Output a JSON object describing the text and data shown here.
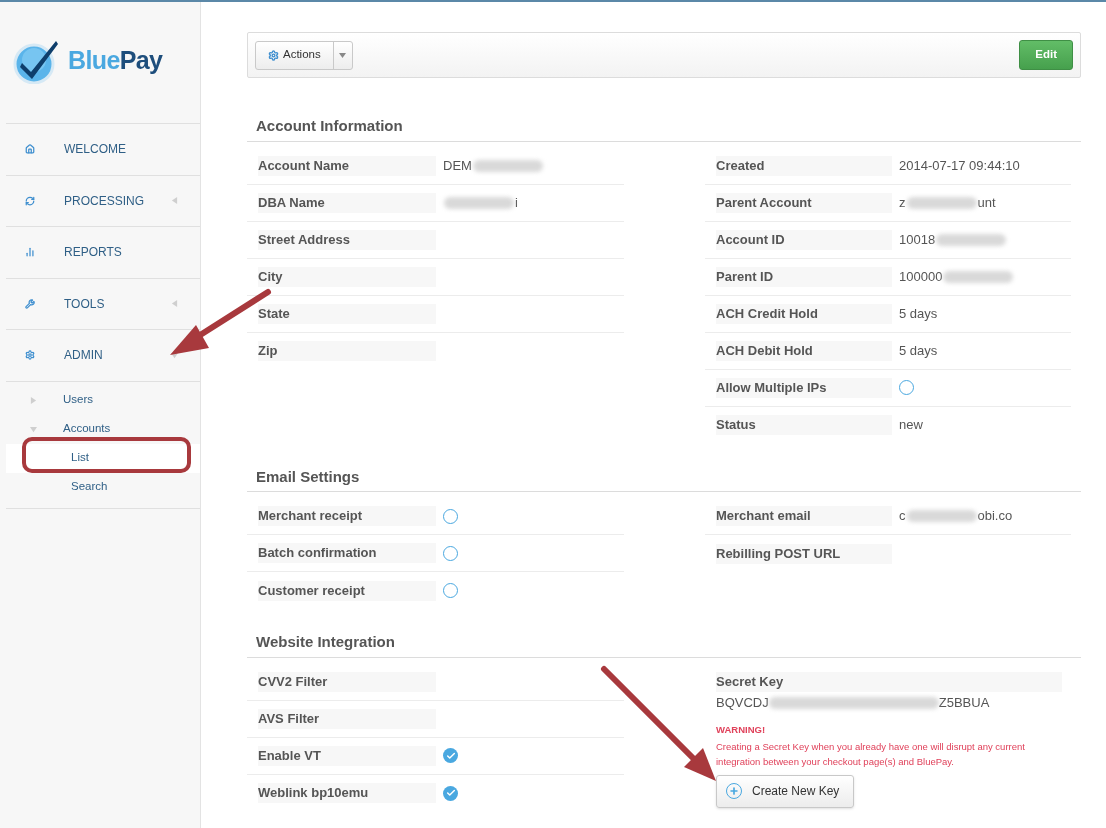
{
  "logo": {
    "text_light": "Blue",
    "text_dark": "Pay"
  },
  "sidebar": {
    "items": [
      {
        "label": "WELCOME"
      },
      {
        "label": "PROCESSING",
        "expanded": false
      },
      {
        "label": "REPORTS"
      },
      {
        "label": "TOOLS",
        "expanded": false
      },
      {
        "label": "ADMIN",
        "expanded": true,
        "children": [
          {
            "label": "Users",
            "expanded": false
          },
          {
            "label": "Accounts",
            "expanded": true,
            "children": [
              {
                "label": "List",
                "selected": true
              },
              {
                "label": "Search",
                "selected": false
              }
            ]
          }
        ]
      }
    ]
  },
  "toolbar": {
    "actions_label": "Actions",
    "edit_label": "Edit"
  },
  "sections": [
    {
      "title": "Account Information",
      "left": [
        {
          "label": "Account Name",
          "kind": "text",
          "value": "DEM",
          "redacted": true
        },
        {
          "label": "DBA Name",
          "kind": "text",
          "value_end": "i",
          "redacted": true
        },
        {
          "label": "Street Address",
          "kind": "text"
        },
        {
          "label": "City",
          "kind": "text"
        },
        {
          "label": "State",
          "kind": "text"
        },
        {
          "label": "Zip",
          "kind": "text"
        }
      ],
      "right": [
        {
          "label": "Created",
          "kind": "text",
          "value": "2014-07-17 09:44:10"
        },
        {
          "label": "Parent Account",
          "kind": "text",
          "value": "z",
          "value_end": "unt",
          "redacted": true
        },
        {
          "label": "Account ID",
          "kind": "text",
          "value": "10018",
          "redacted": true
        },
        {
          "label": "Parent ID",
          "kind": "text",
          "value": "100000",
          "redacted": true
        },
        {
          "label": "ACH Credit Hold",
          "kind": "text",
          "value": "5 days"
        },
        {
          "label": "ACH Debit Hold",
          "kind": "text",
          "value": "5 days"
        },
        {
          "label": "Allow Multiple IPs",
          "kind": "check",
          "checked": false
        },
        {
          "label": "Status",
          "kind": "text",
          "value": "new"
        }
      ]
    },
    {
      "title": "Email Settings",
      "left": [
        {
          "label": "Merchant receipt",
          "kind": "check",
          "checked": false
        },
        {
          "label": "Batch confirmation",
          "kind": "check",
          "checked": false
        },
        {
          "label": "Customer receipt",
          "kind": "check",
          "checked": false
        }
      ],
      "right": [
        {
          "label": "Merchant email",
          "kind": "text",
          "value": "c",
          "value_end": "obi.co",
          "redacted": true
        },
        {
          "label": "Rebilling POST URL",
          "kind": "text"
        }
      ]
    },
    {
      "title": "Website Integration",
      "left": [
        {
          "label": "CVV2 Filter",
          "kind": "text"
        },
        {
          "label": "AVS Filter",
          "kind": "text"
        },
        {
          "label": "Enable VT",
          "kind": "check",
          "checked": true
        },
        {
          "label": "Weblink bp10emu",
          "kind": "check",
          "checked": true
        }
      ],
      "right": [
        {
          "label": "Secret Key",
          "kind": "key",
          "value": "BQVCDJ",
          "value_end": "Z5BBUA",
          "redacted": true,
          "warning_title": "WARNING!",
          "warning_text": "Creating a Secret Key when you already have one will disrupt any current integration between your checkout page(s) and BluePay.",
          "button": "Create New Key"
        }
      ]
    }
  ]
}
